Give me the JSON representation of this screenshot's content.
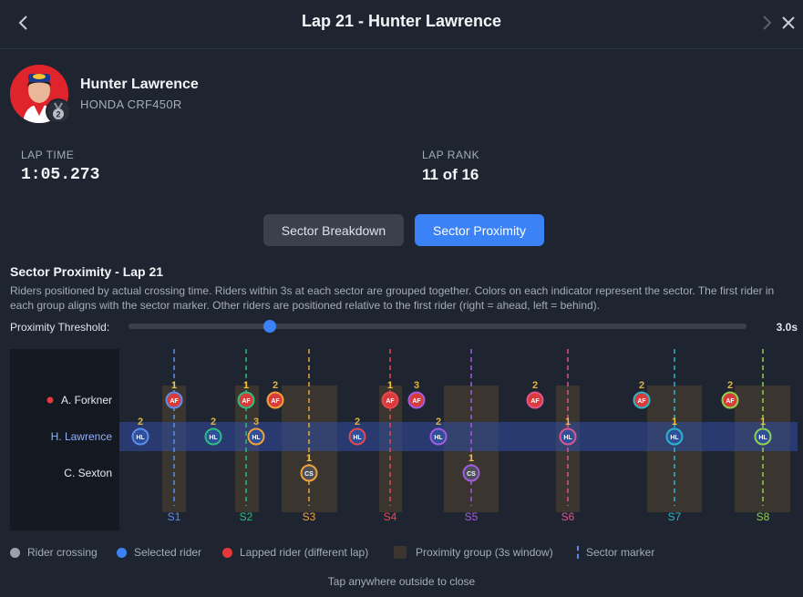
{
  "header": {
    "title": "Lap 21 - Hunter Lawrence"
  },
  "rider": {
    "name": "Hunter Lawrence",
    "bike": "HONDA CRF450R",
    "position_badge": "2"
  },
  "stats": {
    "lap_time_label": "LAP TIME",
    "lap_time": "1:05.273",
    "lap_rank_label": "LAP RANK",
    "lap_rank": "11 of 16"
  },
  "tabs": [
    {
      "label": "Sector Breakdown",
      "active": false
    },
    {
      "label": "Sector Proximity",
      "active": true
    }
  ],
  "section": {
    "title": "Sector Proximity - Lap 21",
    "description": "Riders positioned by actual crossing time. Riders within 3s at each sector are grouped together. Colors on each indicator represent the sector. The first rider in each group aligns with the sector marker. Other riders are positioned relative to the first rider (right = ahead, left = behind)."
  },
  "threshold": {
    "label": "Proximity Threshold:",
    "value_label": "3.0s",
    "value_seconds": 3.0,
    "fraction": 0.228
  },
  "colors": {
    "accent": "#3b82f6",
    "lapped": "#e5383b",
    "group": "#3d3630",
    "sectors": [
      "#5b8def",
      "#2dbd7e",
      "#f0a23a",
      "#e5484d",
      "#a35be0",
      "#e0558e",
      "#2ab6c9",
      "#8fd14f"
    ]
  },
  "chart_data": {
    "type": "scatter",
    "riders": [
      {
        "name": "A. Forkner",
        "initials": "AF",
        "lapped": true,
        "selected": false
      },
      {
        "name": "H. Lawrence",
        "initials": "HL",
        "lapped": false,
        "selected": true
      },
      {
        "name": "C. Sexton",
        "initials": "CS",
        "lapped": false,
        "selected": false
      }
    ],
    "sectors": [
      "S1",
      "S2",
      "S3",
      "S4",
      "S5",
      "S6",
      "S7",
      "S8"
    ],
    "points": [
      {
        "rider": 0,
        "sector": 0,
        "rank": "1"
      },
      {
        "rider": 1,
        "sector": 0,
        "rank": "2"
      },
      {
        "rider": 0,
        "sector": 1,
        "rank": "1"
      },
      {
        "rider": 1,
        "sector": 1,
        "rank": "2"
      },
      {
        "rider": 1,
        "sector": 2,
        "rank": "3"
      },
      {
        "rider": 0,
        "sector": 2,
        "rank": "2"
      },
      {
        "rider": 2,
        "sector": 2,
        "rank": "1"
      },
      {
        "rider": 0,
        "sector": 3,
        "rank": "1"
      },
      {
        "rider": 1,
        "sector": 3,
        "rank": "2"
      },
      {
        "rider": 0,
        "sector": 4,
        "rank": "3"
      },
      {
        "rider": 1,
        "sector": 4,
        "rank": "2"
      },
      {
        "rider": 2,
        "sector": 4,
        "rank": "1"
      },
      {
        "rider": 0,
        "sector": 5,
        "rank": "2"
      },
      {
        "rider": 1,
        "sector": 5,
        "rank": "1"
      },
      {
        "rider": 0,
        "sector": 6,
        "rank": "2"
      },
      {
        "rider": 1,
        "sector": 6,
        "rank": "1"
      },
      {
        "rider": 0,
        "sector": 7,
        "rank": "2"
      },
      {
        "rider": 1,
        "sector": 7,
        "rank": "1"
      }
    ]
  },
  "legend": {
    "crossing": "Rider crossing",
    "selected": "Selected rider",
    "lapped": "Lapped rider (different lap)",
    "group": "Proximity group (3s window)",
    "marker": "Sector marker"
  },
  "footer": {
    "hint": "Tap anywhere outside to close"
  }
}
